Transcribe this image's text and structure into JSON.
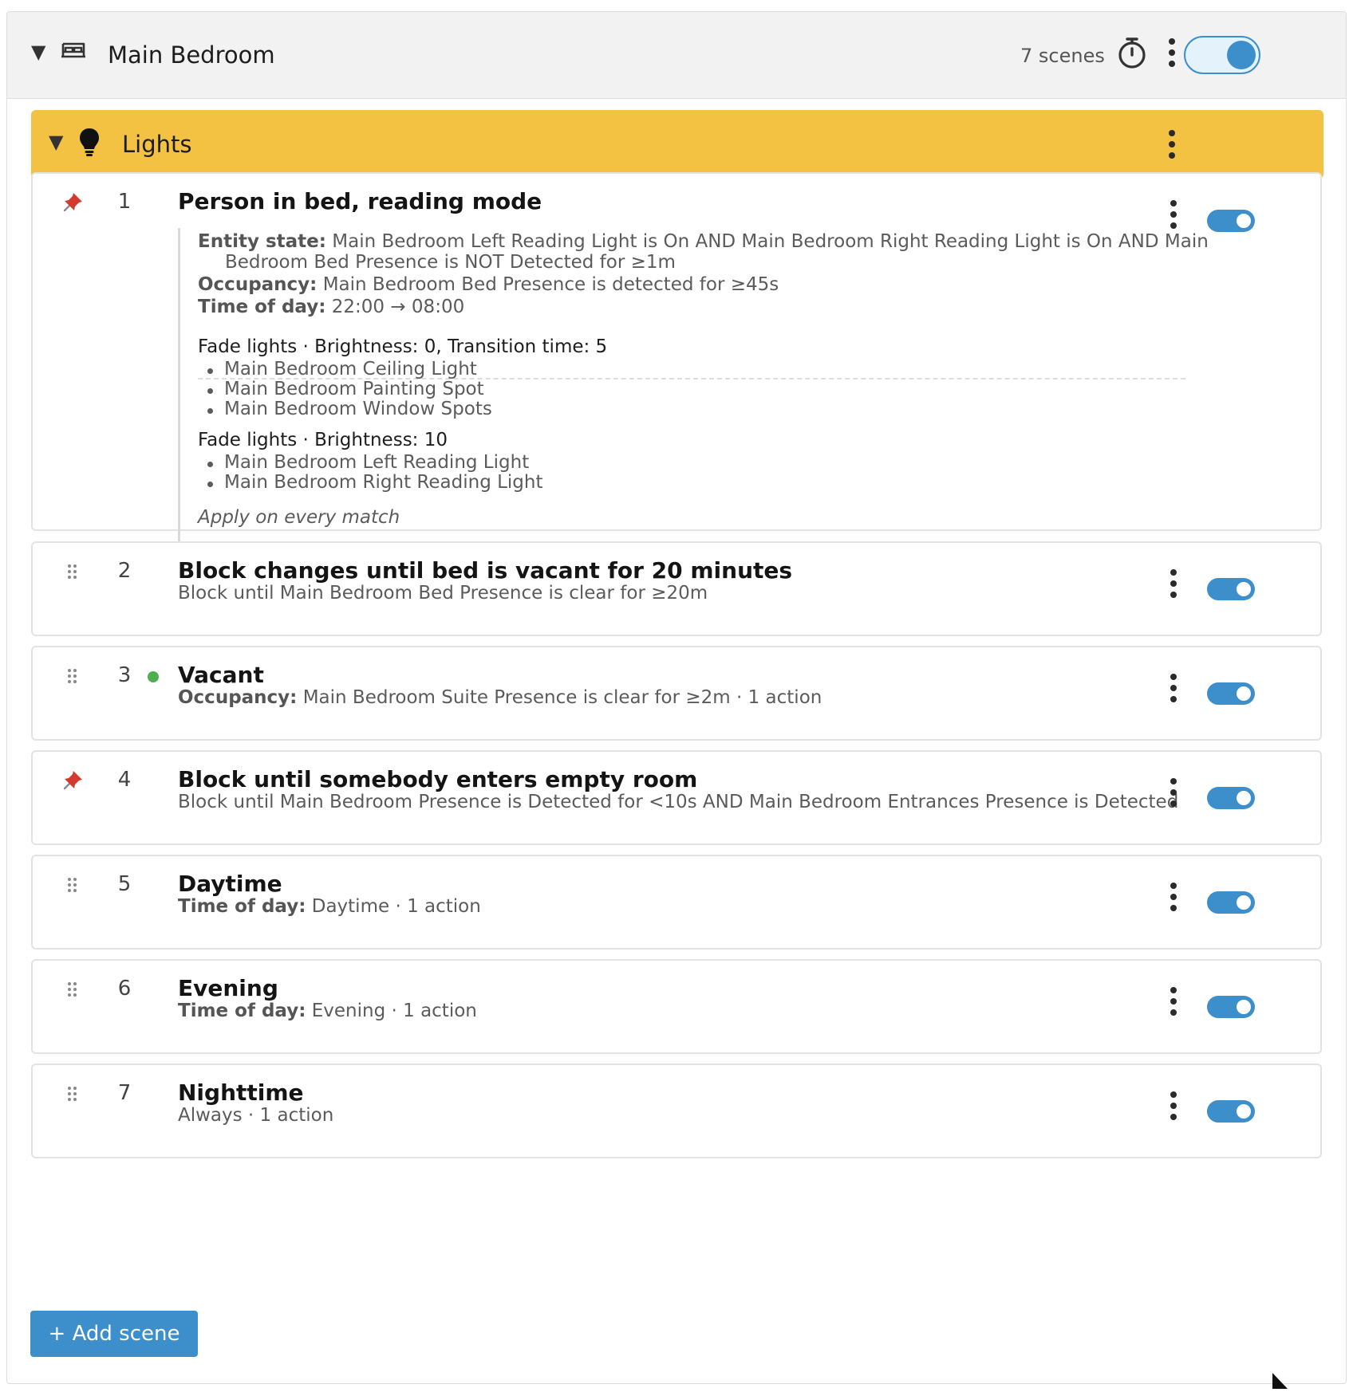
{
  "room": {
    "title": "Main Bedroom",
    "scene_count": "7 scenes",
    "enabled": true
  },
  "group": {
    "title": "Lights",
    "color": "#f4c242"
  },
  "scenes": [
    {
      "number": "1",
      "title": "Person in bed, reading mode",
      "pinned": true,
      "enabled": true,
      "conditions": [
        {
          "label": "Entity state:",
          "text": "Main Bedroom Left Reading Light is On AND Main Bedroom Right Reading Light is On AND Main",
          "cont": "Bedroom Bed Presence is NOT Detected for ≥1m"
        },
        {
          "label": "Occupancy:",
          "text": "Main Bedroom Bed Presence is detected for ≥45s"
        },
        {
          "label": "Time of day:",
          "text": "22:00 → 08:00"
        }
      ],
      "actions": [
        {
          "head": "Fade lights · Brightness: 0, Transition time: 5",
          "items": [
            "Main Bedroom Ceiling Light",
            "Main Bedroom Painting Spot",
            "Main Bedroom Window Spots"
          ]
        },
        {
          "head": "Fade lights · Brightness: 10",
          "items": [
            "Main Bedroom Left Reading Light",
            "Main Bedroom Right Reading Light"
          ]
        }
      ],
      "footer": "Apply on every match"
    },
    {
      "number": "2",
      "title": "Block changes until bed is vacant for 20 minutes",
      "sub_label": "",
      "sub_text": "Block until Main Bedroom Bed Presence is clear for ≥20m",
      "enabled": true
    },
    {
      "number": "3",
      "title": "Vacant",
      "sub_label": "Occupancy:",
      "sub_text": "Main Bedroom Suite Presence is clear for ≥2m · 1 action",
      "active": true,
      "enabled": true
    },
    {
      "number": "4",
      "title": "Block until somebody enters empty room",
      "sub_label": "",
      "sub_text": "Block until Main Bedroom Presence is Detected for <10s AND Main Bedroom Entrances Presence is Detected",
      "pinned": true,
      "enabled": true
    },
    {
      "number": "5",
      "title": "Daytime",
      "sub_label": "Time of day:",
      "sub_text": "Daytime · 1 action",
      "enabled": true
    },
    {
      "number": "6",
      "title": "Evening",
      "sub_label": "Time of day:",
      "sub_text": "Evening · 1 action",
      "enabled": true
    },
    {
      "number": "7",
      "title": "Nighttime",
      "sub_label": "",
      "sub_text": "Always · 1 action",
      "enabled": true
    }
  ],
  "add_scene_label": "+ Add scene",
  "colors": {
    "accent": "#3d8fcc",
    "active_dot": "#4caf50",
    "pin": "#d23a2e"
  }
}
